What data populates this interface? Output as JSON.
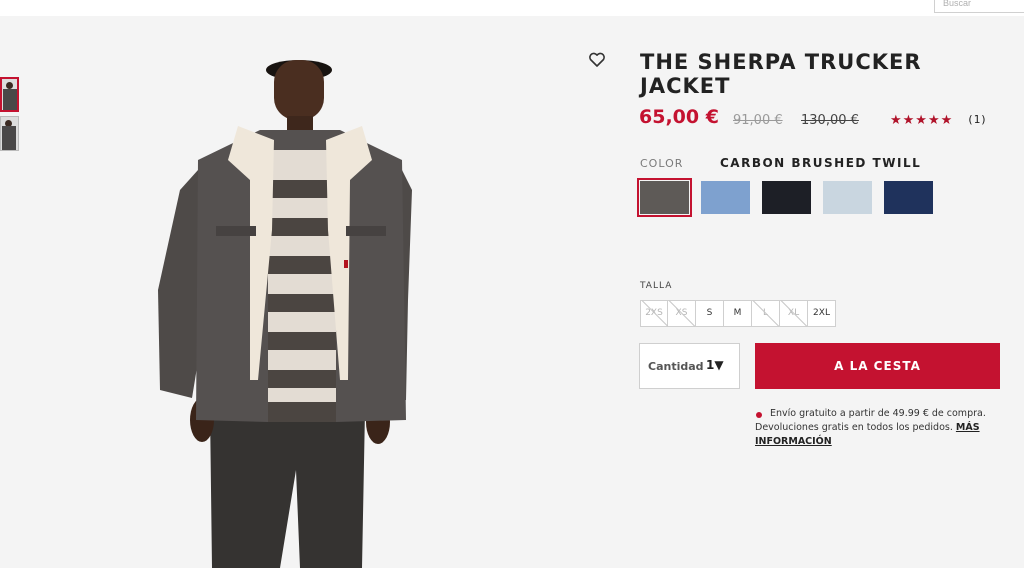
{
  "header": {
    "search_placeholder": "Buscar"
  },
  "product": {
    "title": "THE SHERPA TRUCKER JACKET",
    "price_sale": "65,00 €",
    "price_old_1": "91,00 €",
    "price_old_2": "130,00 €",
    "rating_stars": "★★★★★",
    "rating": 5,
    "review_count": "(1)"
  },
  "color": {
    "label": "COLOR",
    "selected_name": "CARBON BRUSHED TWILL",
    "swatches": [
      "#5e5a57",
      "#7ea1cf",
      "#1d1f26",
      "#c9d6e0",
      "#1f325c"
    ]
  },
  "size": {
    "label": "TALLA",
    "options": [
      {
        "label": "2XS",
        "available": false
      },
      {
        "label": "XS",
        "available": false
      },
      {
        "label": "S",
        "available": true
      },
      {
        "label": "M",
        "available": true
      },
      {
        "label": "L",
        "available": false
      },
      {
        "label": "XL",
        "available": false
      },
      {
        "label": "2XL",
        "available": true
      }
    ]
  },
  "quantity": {
    "label": "Cantidad",
    "value": "1▼"
  },
  "cart": {
    "button_label": "A LA CESTA"
  },
  "shipping": {
    "text": "Envío gratuito a partir de 49.99 € de compra. Devoluciones gratis en todos los pedidos.",
    "link": "MÁS INFORMACIÓN"
  },
  "colors": {
    "accent": "#c41230",
    "background": "#f4f4f4"
  }
}
